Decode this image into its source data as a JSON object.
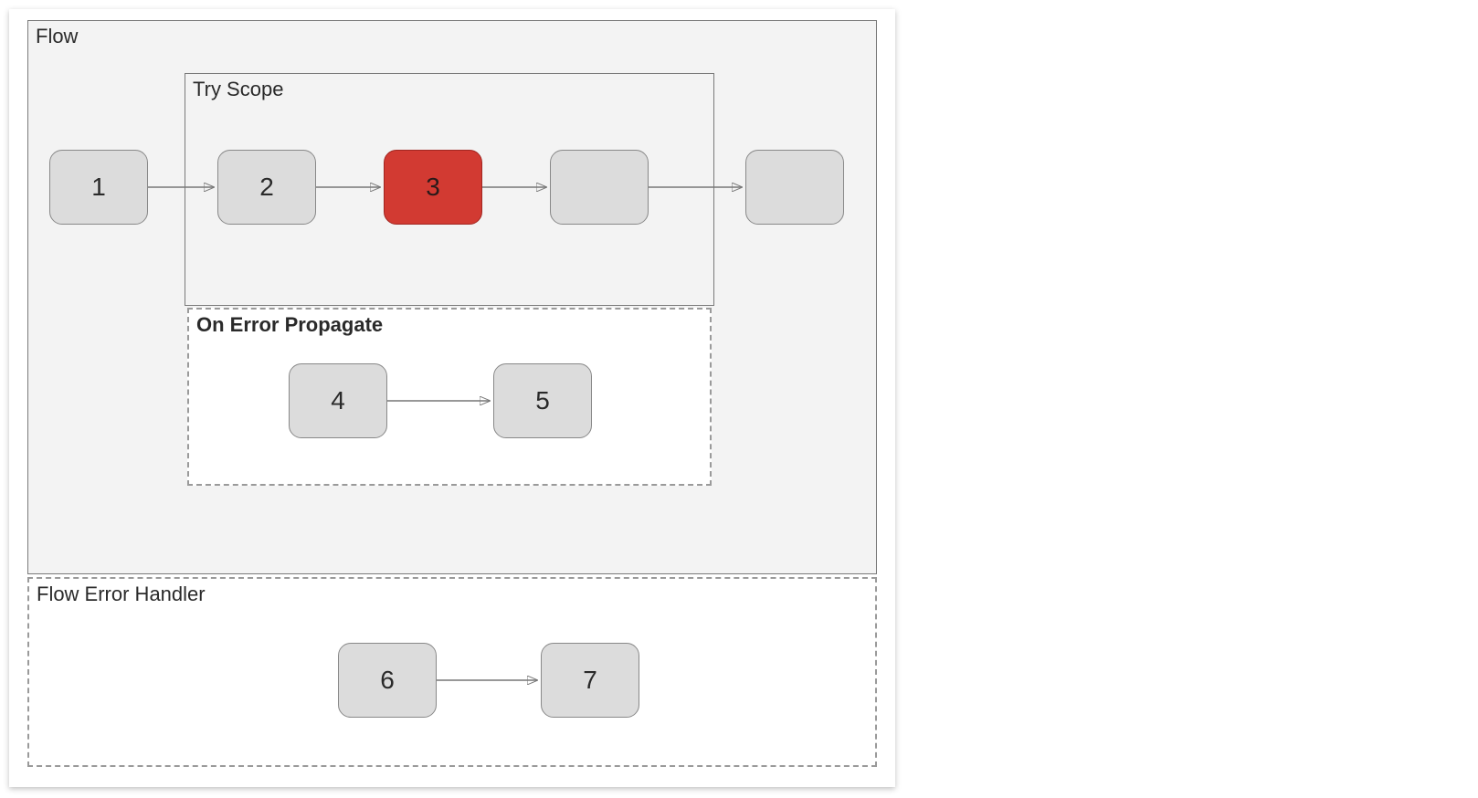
{
  "containers": {
    "flow": {
      "label": "Flow"
    },
    "try_scope": {
      "label": "Try Scope"
    },
    "on_error_propagate": {
      "label": "On Error Propagate"
    },
    "flow_error_handler": {
      "label": "Flow Error Handler"
    }
  },
  "nodes": {
    "n1": "1",
    "n2": "2",
    "n3": "3",
    "n4": "",
    "n5": "",
    "n6": "4",
    "n7": "5",
    "n8": "6",
    "n9": "7"
  },
  "colors": {
    "error_node": "#d23a32"
  }
}
